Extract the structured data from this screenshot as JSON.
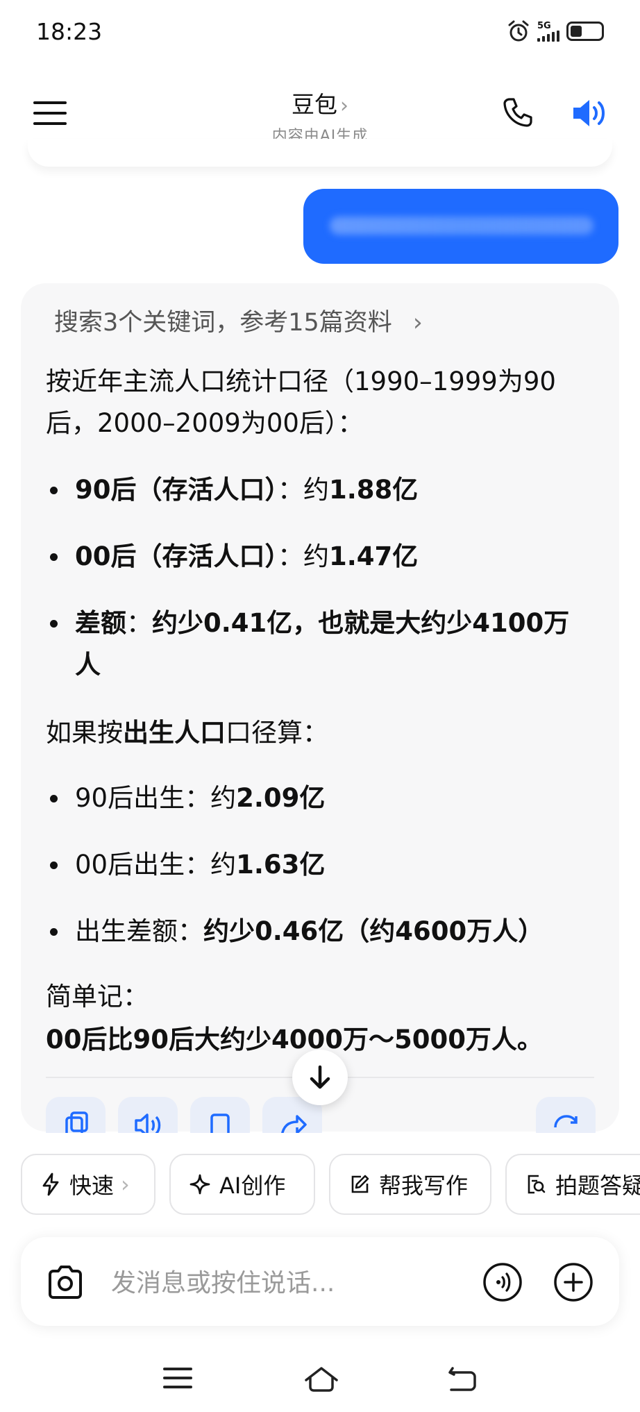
{
  "status_bar": {
    "time": "18:23",
    "network": "5G"
  },
  "header": {
    "title": "豆包",
    "title_chevron": "›",
    "subtitle": "内容由AI生成",
    "icons": [
      "menu-icon",
      "phone-icon",
      "speaker-icon"
    ]
  },
  "answer": {
    "search_summary": "搜索3个关键词，参考15篇资料",
    "search_chevron": "›",
    "intro": "按近年主流人口统计口径（1990–1999为90后，2000–2009为00后）：",
    "group1": [
      {
        "label": "90后（存活人口）",
        "sep": "：",
        "prefix": "约",
        "value": "1.88亿"
      },
      {
        "label": "00后（存活人口）",
        "sep": "：",
        "prefix": "约",
        "value": "1.47亿"
      },
      {
        "label": "差额",
        "sep": "：",
        "value": "约少0.41亿，也就是大约少4100万人"
      }
    ],
    "birth_intro_pre": "如果按",
    "birth_intro_bold": "出生人口",
    "birth_intro_post": "口径算：",
    "group2": [
      {
        "label": "90后出生",
        "sep": "：",
        "prefix": "约",
        "value": "2.09亿"
      },
      {
        "label": "00后出生",
        "sep": "：",
        "prefix": "约",
        "value": "1.63亿"
      },
      {
        "label": "出生差额",
        "sep": "：",
        "value": "约少0.46亿（约4600万人）"
      }
    ],
    "summary_label": "简单记：",
    "summary": "00后比90后大约少4000万～5000万人。"
  },
  "chips": [
    {
      "label": "快速",
      "icon": "lightning-icon",
      "chevron": "›"
    },
    {
      "label": "AI创作",
      "icon": "sparkle-icon"
    },
    {
      "label": "帮我写作",
      "icon": "edit-icon"
    },
    {
      "label": "拍题答疑",
      "icon": "scan-question-icon"
    }
  ],
  "composer": {
    "placeholder": "发消息或按住说话..."
  },
  "colors": {
    "accent": "#1f6bff",
    "card_bg": "#f7f7f8"
  }
}
